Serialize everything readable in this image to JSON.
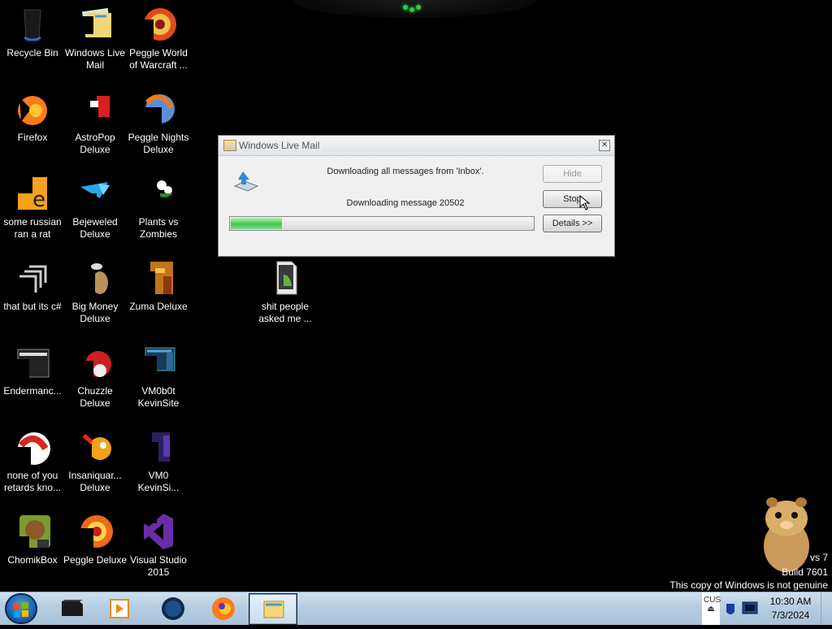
{
  "desktop_icons": [
    {
      "label": "Recycle Bin",
      "icon": "recycle-bin-icon"
    },
    {
      "label": "Windows Live\nMail",
      "icon": "windows-live-mail-icon"
    },
    {
      "label": "Peggle World\nof Warcraft ...",
      "icon": "peggle-wow-icon"
    },
    {
      "label": "Firefox",
      "icon": "firefox-icon"
    },
    {
      "label": "AstroPop\nDeluxe",
      "icon": "astropop-icon"
    },
    {
      "label": "Peggle Nights\nDeluxe",
      "icon": "peggle-nights-icon"
    },
    {
      "label": "some russian\nran a rat",
      "icon": "rat-shortcut-icon"
    },
    {
      "label": "Bejeweled\nDeluxe",
      "icon": "bejeweled-icon"
    },
    {
      "label": "Plants vs\nZombies",
      "icon": "plants-vs-zombies-icon"
    },
    {
      "label": "that but its c#",
      "icon": "copy-shortcut-icon"
    },
    {
      "label": "Big Money\nDeluxe",
      "icon": "big-money-icon"
    },
    {
      "label": "Zuma Deluxe",
      "icon": "zuma-icon"
    },
    {
      "label": "Endermanc...",
      "icon": "console-icon"
    },
    {
      "label": "Chuzzle\nDeluxe",
      "icon": "chuzzle-icon"
    },
    {
      "label": "VM0b0t\nKevinSite",
      "icon": "vm0b0t-icon"
    },
    {
      "label": "none of you\nretards kno...",
      "icon": "shortcut-icon"
    },
    {
      "label": "Insaniquar...\nDeluxe",
      "icon": "insaniquarium-icon"
    },
    {
      "label": "VM0\nKevinSi...",
      "icon": "vm0-icon"
    },
    {
      "label": "ChomikBox",
      "icon": "chomikbox-icon"
    },
    {
      "label": "Peggle Deluxe",
      "icon": "peggle-icon"
    },
    {
      "label": "Visual Studio\n2015",
      "icon": "visual-studio-icon"
    },
    {
      "label": "shit people\nasked me ...",
      "icon": "folder-icon"
    }
  ],
  "dialog": {
    "title": "Windows Live Mail",
    "status_line": "Downloading all messages from 'Inbox'.",
    "progress_line": "Downloading message 20502",
    "progress": 0.17,
    "buttons": {
      "hide": "Hide",
      "stop": "Stop",
      "details": "Details >>"
    }
  },
  "watermark": {
    "line1": "vs 7",
    "line2": "Build 7601",
    "line3": "This copy of Windows is not genuine"
  },
  "taskbar": {
    "apps": [
      {
        "name": "console-app-icon"
      },
      {
        "name": "media-player-icon"
      },
      {
        "name": "globe-app-icon"
      },
      {
        "name": "firefox-icon"
      },
      {
        "name": "windows-live-mail-icon",
        "active": true
      }
    ],
    "tray_text": "CUS",
    "time": "10:30 AM",
    "date": "7/3/2024"
  }
}
